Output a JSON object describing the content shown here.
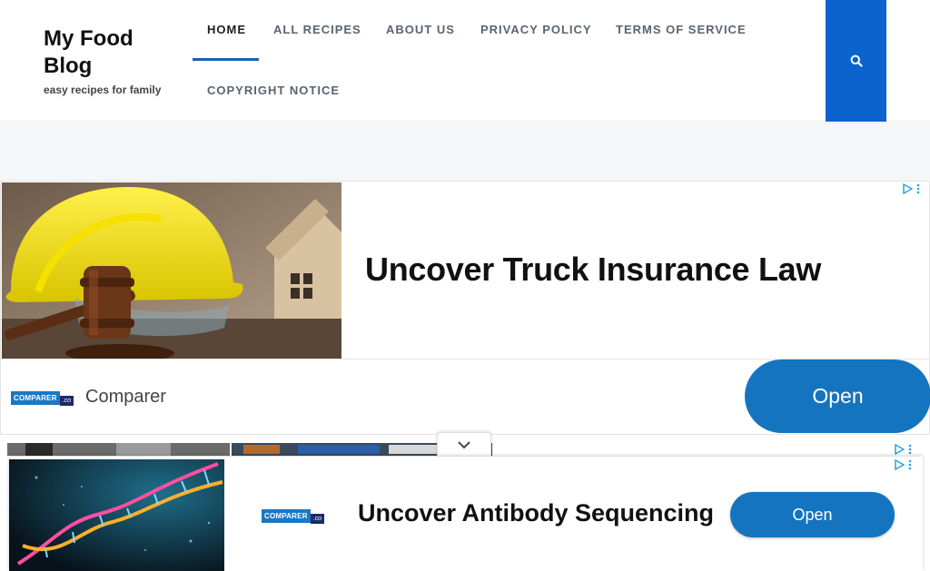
{
  "site": {
    "title": "My Food Blog",
    "tagline": "easy recipes for family"
  },
  "nav": {
    "items": [
      {
        "label": "HOME",
        "active": true
      },
      {
        "label": "ALL RECIPES"
      },
      {
        "label": "ABOUT US"
      },
      {
        "label": "PRIVACY POLICY"
      },
      {
        "label": "TERMS OF SERVICE"
      },
      {
        "label": "COPYRIGHT NOTICE"
      }
    ],
    "search_icon": "search-icon",
    "accent_color": "#0b63ce"
  },
  "ad_top": {
    "headline": "Uncover Truck Insurance Law",
    "advertiser": "Comparer",
    "cta": "Open",
    "logo_text": "COMPARER",
    "logo_suffix": ".co"
  },
  "ad_bottom": {
    "headline": "Uncover Antibody Sequencing",
    "cta": "Open",
    "logo_text": "COMPARER",
    "logo_suffix": ".co"
  },
  "colors": {
    "cta_blue": "#1474bf"
  }
}
